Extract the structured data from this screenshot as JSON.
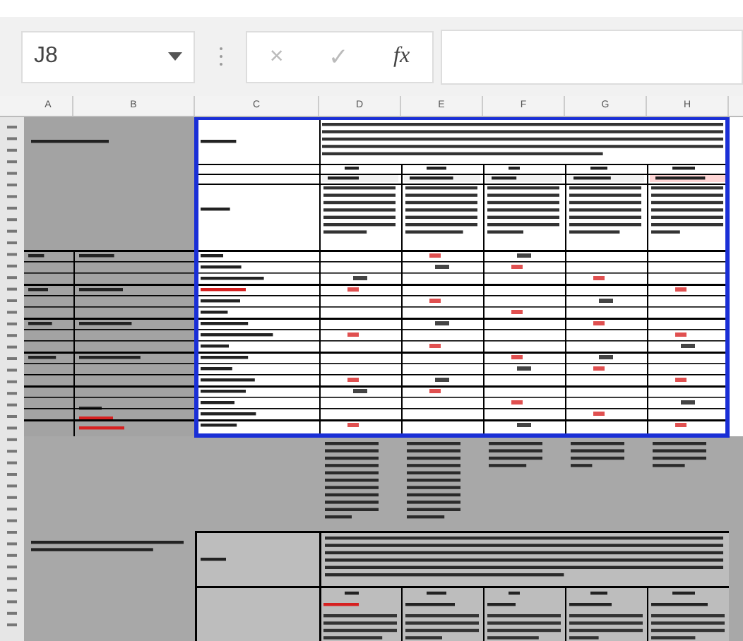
{
  "name_box": {
    "value": "J8"
  },
  "formula_bar": {
    "cancel": "×",
    "enter": "✓",
    "function": "fx"
  },
  "sheet": {
    "columns": [
      "A",
      "B",
      "C",
      "D",
      "E",
      "F",
      "G",
      "H"
    ]
  }
}
